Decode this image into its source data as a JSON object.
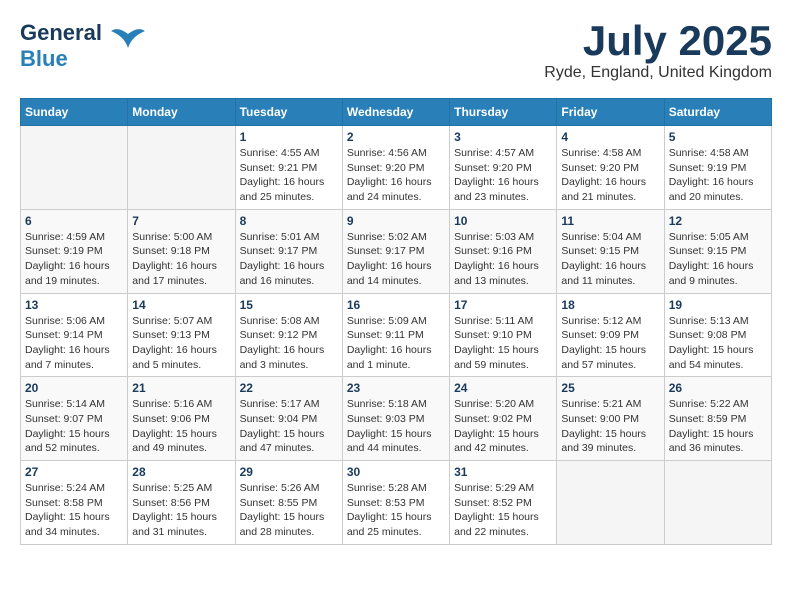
{
  "header": {
    "logo_general": "General",
    "logo_blue": "Blue",
    "title": "July 2025",
    "location": "Ryde, England, United Kingdom"
  },
  "weekdays": [
    "Sunday",
    "Monday",
    "Tuesday",
    "Wednesday",
    "Thursday",
    "Friday",
    "Saturday"
  ],
  "weeks": [
    [
      {
        "day": "",
        "info": ""
      },
      {
        "day": "",
        "info": ""
      },
      {
        "day": "1",
        "info": "Sunrise: 4:55 AM\nSunset: 9:21 PM\nDaylight: 16 hours and 25 minutes."
      },
      {
        "day": "2",
        "info": "Sunrise: 4:56 AM\nSunset: 9:20 PM\nDaylight: 16 hours and 24 minutes."
      },
      {
        "day": "3",
        "info": "Sunrise: 4:57 AM\nSunset: 9:20 PM\nDaylight: 16 hours and 23 minutes."
      },
      {
        "day": "4",
        "info": "Sunrise: 4:58 AM\nSunset: 9:20 PM\nDaylight: 16 hours and 21 minutes."
      },
      {
        "day": "5",
        "info": "Sunrise: 4:58 AM\nSunset: 9:19 PM\nDaylight: 16 hours and 20 minutes."
      }
    ],
    [
      {
        "day": "6",
        "info": "Sunrise: 4:59 AM\nSunset: 9:19 PM\nDaylight: 16 hours and 19 minutes."
      },
      {
        "day": "7",
        "info": "Sunrise: 5:00 AM\nSunset: 9:18 PM\nDaylight: 16 hours and 17 minutes."
      },
      {
        "day": "8",
        "info": "Sunrise: 5:01 AM\nSunset: 9:17 PM\nDaylight: 16 hours and 16 minutes."
      },
      {
        "day": "9",
        "info": "Sunrise: 5:02 AM\nSunset: 9:17 PM\nDaylight: 16 hours and 14 minutes."
      },
      {
        "day": "10",
        "info": "Sunrise: 5:03 AM\nSunset: 9:16 PM\nDaylight: 16 hours and 13 minutes."
      },
      {
        "day": "11",
        "info": "Sunrise: 5:04 AM\nSunset: 9:15 PM\nDaylight: 16 hours and 11 minutes."
      },
      {
        "day": "12",
        "info": "Sunrise: 5:05 AM\nSunset: 9:15 PM\nDaylight: 16 hours and 9 minutes."
      }
    ],
    [
      {
        "day": "13",
        "info": "Sunrise: 5:06 AM\nSunset: 9:14 PM\nDaylight: 16 hours and 7 minutes."
      },
      {
        "day": "14",
        "info": "Sunrise: 5:07 AM\nSunset: 9:13 PM\nDaylight: 16 hours and 5 minutes."
      },
      {
        "day": "15",
        "info": "Sunrise: 5:08 AM\nSunset: 9:12 PM\nDaylight: 16 hours and 3 minutes."
      },
      {
        "day": "16",
        "info": "Sunrise: 5:09 AM\nSunset: 9:11 PM\nDaylight: 16 hours and 1 minute."
      },
      {
        "day": "17",
        "info": "Sunrise: 5:11 AM\nSunset: 9:10 PM\nDaylight: 15 hours and 59 minutes."
      },
      {
        "day": "18",
        "info": "Sunrise: 5:12 AM\nSunset: 9:09 PM\nDaylight: 15 hours and 57 minutes."
      },
      {
        "day": "19",
        "info": "Sunrise: 5:13 AM\nSunset: 9:08 PM\nDaylight: 15 hours and 54 minutes."
      }
    ],
    [
      {
        "day": "20",
        "info": "Sunrise: 5:14 AM\nSunset: 9:07 PM\nDaylight: 15 hours and 52 minutes."
      },
      {
        "day": "21",
        "info": "Sunrise: 5:16 AM\nSunset: 9:06 PM\nDaylight: 15 hours and 49 minutes."
      },
      {
        "day": "22",
        "info": "Sunrise: 5:17 AM\nSunset: 9:04 PM\nDaylight: 15 hours and 47 minutes."
      },
      {
        "day": "23",
        "info": "Sunrise: 5:18 AM\nSunset: 9:03 PM\nDaylight: 15 hours and 44 minutes."
      },
      {
        "day": "24",
        "info": "Sunrise: 5:20 AM\nSunset: 9:02 PM\nDaylight: 15 hours and 42 minutes."
      },
      {
        "day": "25",
        "info": "Sunrise: 5:21 AM\nSunset: 9:00 PM\nDaylight: 15 hours and 39 minutes."
      },
      {
        "day": "26",
        "info": "Sunrise: 5:22 AM\nSunset: 8:59 PM\nDaylight: 15 hours and 36 minutes."
      }
    ],
    [
      {
        "day": "27",
        "info": "Sunrise: 5:24 AM\nSunset: 8:58 PM\nDaylight: 15 hours and 34 minutes."
      },
      {
        "day": "28",
        "info": "Sunrise: 5:25 AM\nSunset: 8:56 PM\nDaylight: 15 hours and 31 minutes."
      },
      {
        "day": "29",
        "info": "Sunrise: 5:26 AM\nSunset: 8:55 PM\nDaylight: 15 hours and 28 minutes."
      },
      {
        "day": "30",
        "info": "Sunrise: 5:28 AM\nSunset: 8:53 PM\nDaylight: 15 hours and 25 minutes."
      },
      {
        "day": "31",
        "info": "Sunrise: 5:29 AM\nSunset: 8:52 PM\nDaylight: 15 hours and 22 minutes."
      },
      {
        "day": "",
        "info": ""
      },
      {
        "day": "",
        "info": ""
      }
    ]
  ]
}
